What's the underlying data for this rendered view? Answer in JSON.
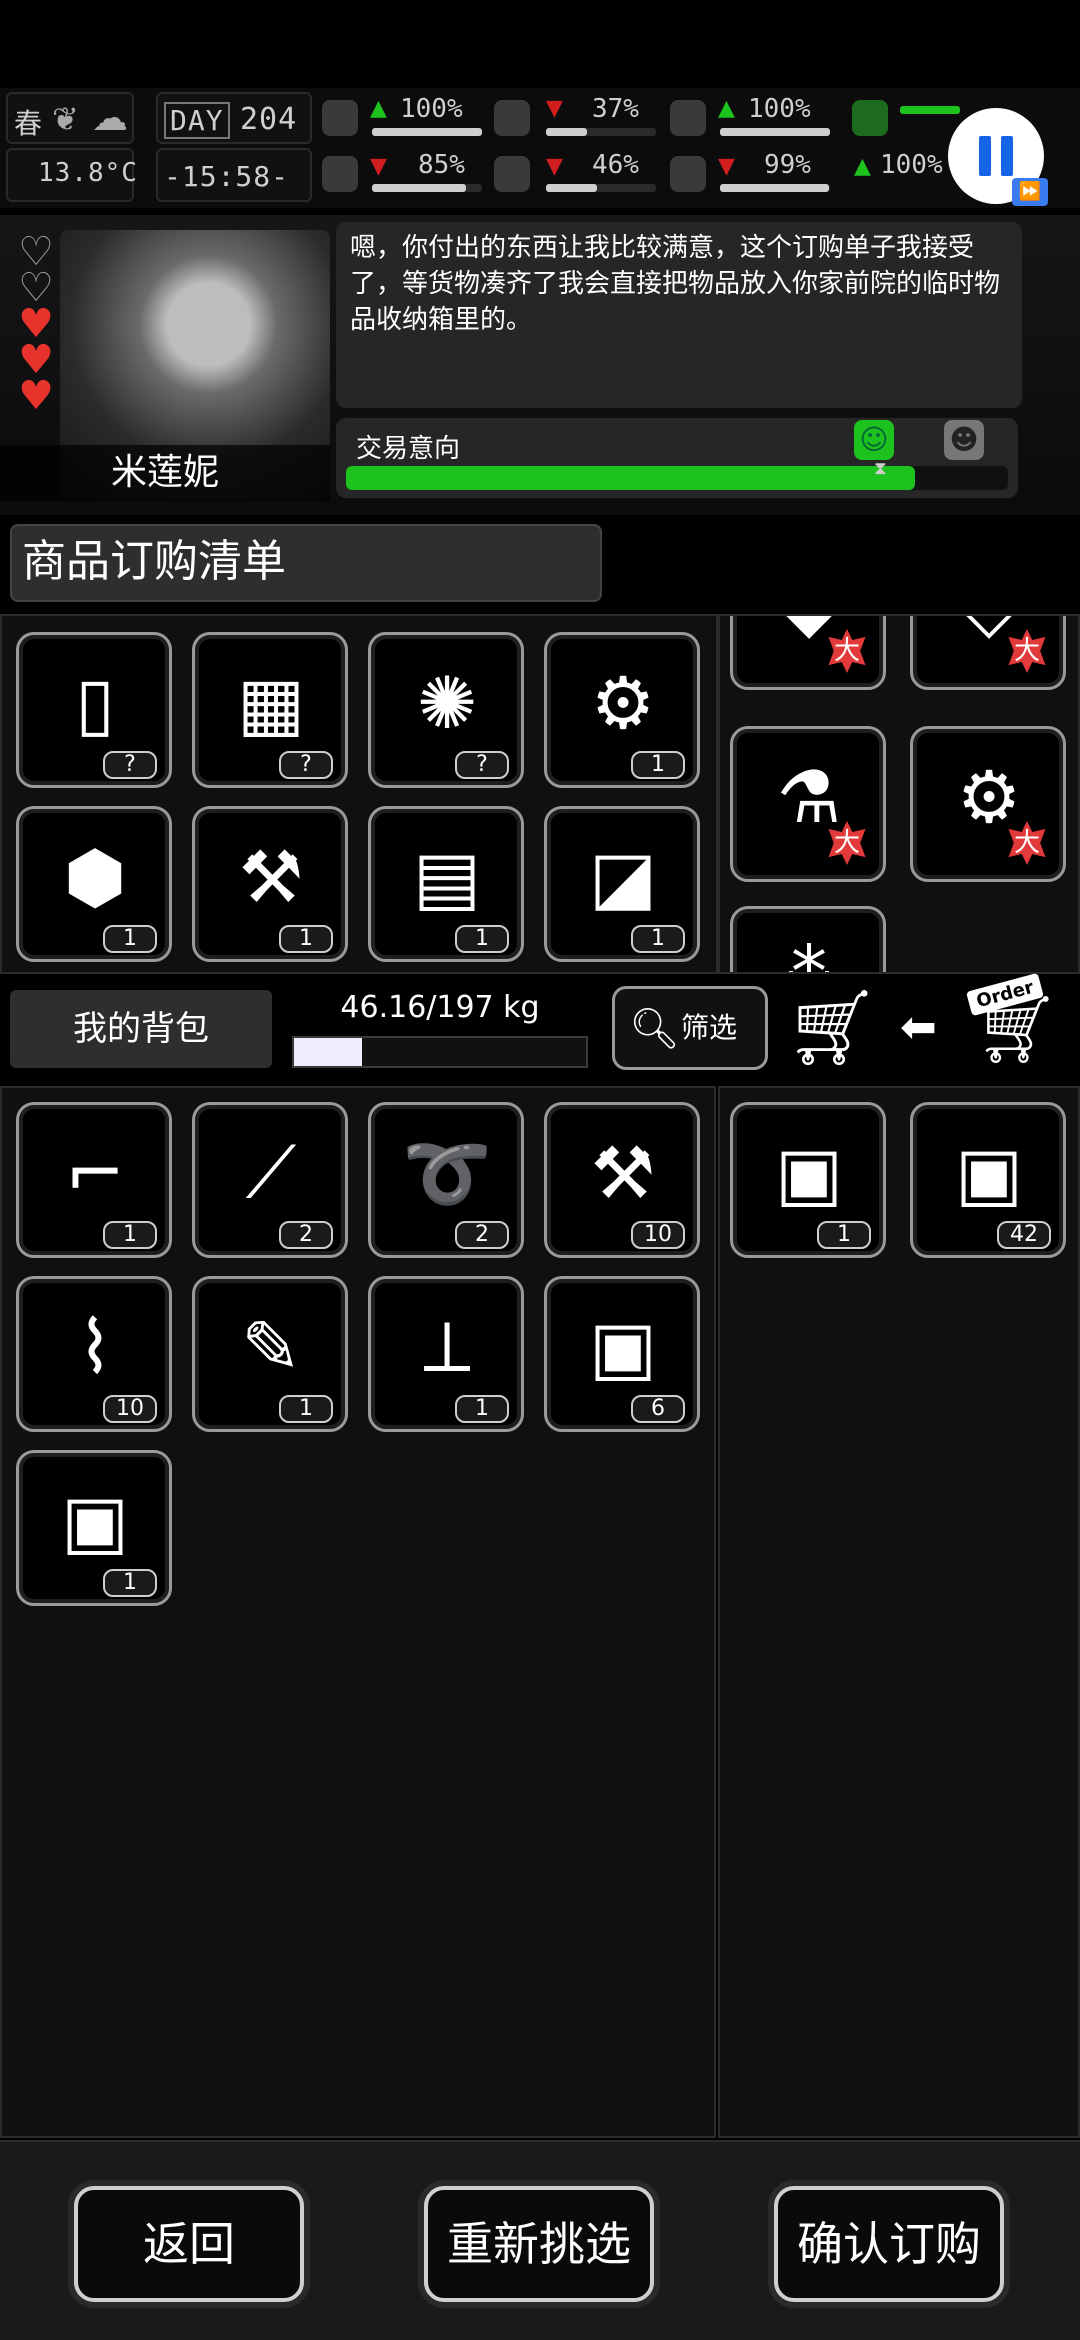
{
  "status": {
    "season": "春",
    "temperature": "13.8°C",
    "day_label": "DAY",
    "day": "204",
    "time": "-15:58-",
    "stats": [
      {
        "name": "health",
        "value": "100%",
        "trend": "up",
        "level": 1.0
      },
      {
        "name": "hunger",
        "value": "37%",
        "trend": "down",
        "level": 0.37
      },
      {
        "name": "armor",
        "value": "100%",
        "trend": "up",
        "level": 1.0
      },
      {
        "name": "sanity",
        "value": "85%",
        "trend": "down",
        "level": 0.85
      },
      {
        "name": "thirst",
        "value": "46%",
        "trend": "down",
        "level": 0.46
      },
      {
        "name": "mood",
        "value": "99%",
        "trend": "down",
        "level": 0.99
      },
      {
        "name": "stamina",
        "value": "100%",
        "trend": "up",
        "level": 1.0
      }
    ]
  },
  "npc": {
    "name": "米莲妮",
    "hearts_filled": 3,
    "hearts_total": 5,
    "dialog": "嗯，你付出的东西让我比较满意，这个订购单子我接受了，等货物凑齐了我会直接把物品放入你家前院的临时物品收纳箱里的。",
    "trade_label": "交易意向",
    "trade_level": 0.86
  },
  "order": {
    "title": "商品订购清单",
    "items": [
      {
        "icon": "cloth-icon",
        "glyph": "▯",
        "qty": "?"
      },
      {
        "icon": "bricks-icon",
        "glyph": "▦",
        "qty": "?"
      },
      {
        "icon": "fur-icon",
        "glyph": "✺",
        "qty": "?"
      },
      {
        "icon": "vise-icon",
        "glyph": "⚙",
        "qty": "1"
      },
      {
        "icon": "machine-part-icon",
        "glyph": "⬢",
        "qty": "1"
      },
      {
        "icon": "pipe-icon",
        "glyph": "⚒",
        "qty": "1"
      },
      {
        "icon": "radiator-icon",
        "glyph": "▤",
        "qty": "1"
      },
      {
        "icon": "heater-icon",
        "glyph": "◪",
        "qty": "1"
      }
    ],
    "reward_badge": "大",
    "rewards": [
      {
        "icon": "yellow-plank-icon",
        "glyph": "◆"
      },
      {
        "icon": "white-cloth-icon",
        "glyph": "◇"
      },
      {
        "icon": "flask-icon",
        "glyph": "⚗"
      },
      {
        "icon": "yellow-parts-icon",
        "glyph": "⚙"
      },
      {
        "icon": "yellow-scrap-icon",
        "glyph": "⁂"
      }
    ]
  },
  "inventory": {
    "tab_label": "我的背包",
    "weight": "46.16/197 kg",
    "weight_fraction": 0.234,
    "filter_label": "筛选",
    "items": [
      {
        "icon": "flare-gun-icon",
        "glyph": "⌐",
        "qty": "1"
      },
      {
        "icon": "lockpick-icon",
        "glyph": "⟋",
        "qty": "2"
      },
      {
        "icon": "rope-icon",
        "glyph": "➰",
        "qty": "2"
      },
      {
        "icon": "toolbox-icon",
        "glyph": "⚒",
        "qty": "10"
      },
      {
        "icon": "bandage-icon",
        "glyph": "⌇",
        "qty": "10"
      },
      {
        "icon": "syringe-icon",
        "glyph": "✎",
        "qty": "1"
      },
      {
        "icon": "knife-icon",
        "glyph": "⟂",
        "qty": "1"
      },
      {
        "icon": "supply-crate-icon",
        "glyph": "▣",
        "qty": "6"
      },
      {
        "icon": "supply-crate-icon",
        "glyph": "▣",
        "qty": "1"
      }
    ],
    "payment": [
      {
        "icon": "supply-crate-icon",
        "glyph": "▣",
        "qty": "1"
      },
      {
        "icon": "supply-crate-icon",
        "glyph": "▣",
        "qty": "42"
      }
    ]
  },
  "order_tag": "Order",
  "buttons": {
    "back": "返回",
    "reselect": "重新挑选",
    "confirm": "确认订购"
  }
}
